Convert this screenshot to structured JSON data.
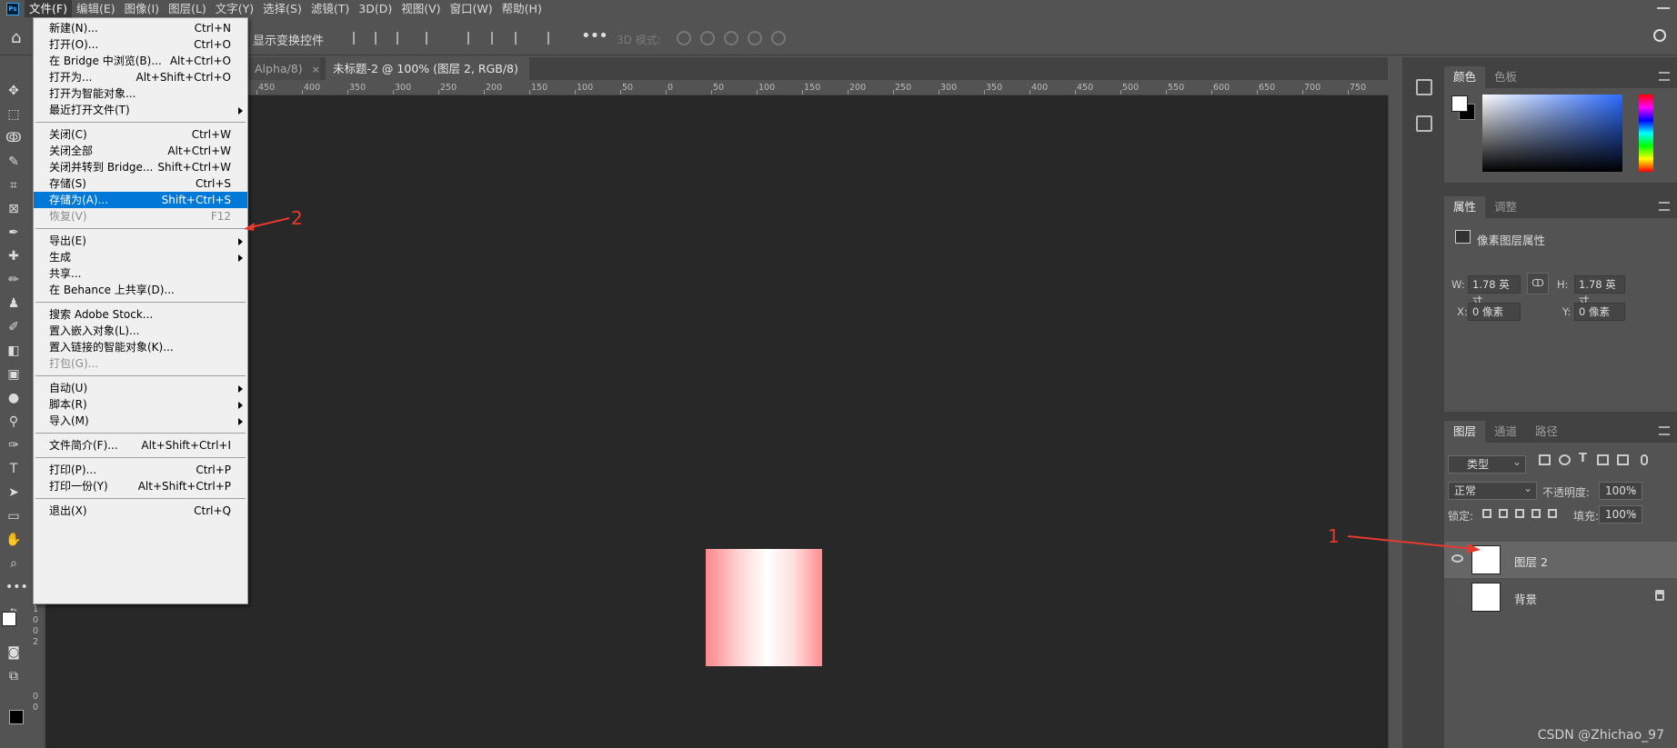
{
  "menubar": {
    "logo": "Ps",
    "items": [
      "文件(F)",
      "编辑(E)",
      "图像(I)",
      "图层(L)",
      "文字(Y)",
      "选择(S)",
      "滤镜(T)",
      "3D(D)",
      "视图(V)",
      "窗口(W)",
      "帮助(H)"
    ]
  },
  "options": {
    "show_transform": "显示变换控件",
    "more": "•••",
    "mode3d": "3D 模式:"
  },
  "tabs": [
    {
      "label": "Alpha/8)",
      "close": "×"
    },
    {
      "label": "未标题-2 @ 100% (图层 2, RGB/8) *",
      "close": "×"
    }
  ],
  "ruler": [
    "450",
    "400",
    "350",
    "300",
    "250",
    "200",
    "150",
    "100",
    "50",
    "0",
    "50",
    "100",
    "150",
    "200",
    "250",
    "300",
    "350",
    "400",
    "450",
    "500",
    "550",
    "600",
    "650",
    "700",
    "750"
  ],
  "vruler": [
    "1",
    "0",
    "0",
    "2",
    "0",
    "0"
  ],
  "file_menu": {
    "items": [
      {
        "label": "新建(N)...",
        "shortcut": "Ctrl+N"
      },
      {
        "label": "打开(O)...",
        "shortcut": "Ctrl+O"
      },
      {
        "label": "在 Bridge 中浏览(B)...",
        "shortcut": "Alt+Ctrl+O"
      },
      {
        "label": "打开为...",
        "shortcut": "Alt+Shift+Ctrl+O"
      },
      {
        "label": "打开为智能对象...",
        "shortcut": ""
      },
      {
        "label": "最近打开文件(T)",
        "shortcut": ""
      },
      {
        "label": "关闭(C)",
        "shortcut": "Ctrl+W"
      },
      {
        "label": "关闭全部",
        "shortcut": "Alt+Ctrl+W"
      },
      {
        "label": "关闭并转到 Bridge...",
        "shortcut": "Shift+Ctrl+W"
      },
      {
        "label": "存储(S)",
        "shortcut": "Ctrl+S"
      },
      {
        "label": "存储为(A)...",
        "shortcut": "Shift+Ctrl+S"
      },
      {
        "label": "恢复(V)",
        "shortcut": "F12"
      },
      {
        "label": "导出(E)",
        "shortcut": ""
      },
      {
        "label": "生成",
        "shortcut": ""
      },
      {
        "label": "共享...",
        "shortcut": ""
      },
      {
        "label": "在 Behance 上共享(D)...",
        "shortcut": ""
      },
      {
        "label": "搜索 Adobe Stock...",
        "shortcut": ""
      },
      {
        "label": "置入嵌入对象(L)...",
        "shortcut": ""
      },
      {
        "label": "置入链接的智能对象(K)...",
        "shortcut": ""
      },
      {
        "label": "打包(G)...",
        "shortcut": ""
      },
      {
        "label": "自动(U)",
        "shortcut": ""
      },
      {
        "label": "脚本(R)",
        "shortcut": ""
      },
      {
        "label": "导入(M)",
        "shortcut": ""
      },
      {
        "label": "文件简介(F)...",
        "shortcut": "Alt+Shift+Ctrl+I"
      },
      {
        "label": "打印(P)...",
        "shortcut": "Ctrl+P"
      },
      {
        "label": "打印一份(Y)",
        "shortcut": "Alt+Shift+Ctrl+P"
      },
      {
        "label": "退出(X)",
        "shortcut": "Ctrl+Q"
      }
    ]
  },
  "color_panel": {
    "tabs": [
      "颜色",
      "色板"
    ],
    "fg": "#ffffff",
    "bg": "#000000"
  },
  "properties_panel": {
    "tabs": [
      "属性",
      "调整"
    ],
    "title": "像素图层属性",
    "w_label": "W:",
    "w_value": "1.78 英寸",
    "h_label": "H:",
    "h_value": "1.78 英寸",
    "x_label": "X:",
    "x_value": "0 像素",
    "y_label": "Y:",
    "y_value": "0 像素",
    "link": "ↀ"
  },
  "layers_panel": {
    "tabs": [
      "图层",
      "通道",
      "路径"
    ],
    "filter_kind": "类型",
    "blend_mode": "正常",
    "opacity_label": "不透明度:",
    "opacity": "100%",
    "lock_label": "锁定:",
    "fill_label": "填充:",
    "fill": "100%",
    "layers": [
      {
        "name": "图层 2",
        "visible": true,
        "selected": true
      },
      {
        "name": "背景",
        "visible": false,
        "locked": true
      }
    ]
  },
  "annotations": {
    "one": "1",
    "two": "2"
  },
  "watermark": "CSDN @Zhichao_97",
  "accent": "#0078d7",
  "annotation_color": "#e53a2e"
}
